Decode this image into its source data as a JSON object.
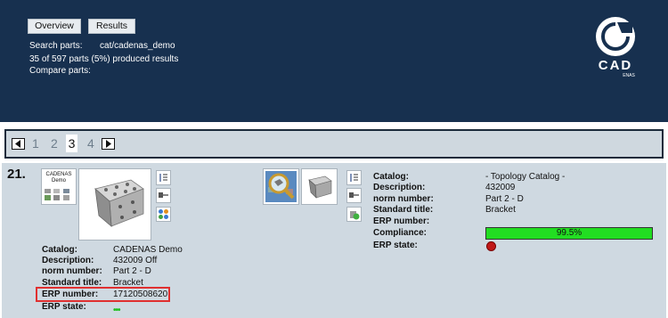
{
  "header": {
    "tabs": [
      {
        "label": "Overview"
      },
      {
        "label": "Results"
      }
    ],
    "search_label": "Search parts:",
    "search_value": "cat/cadenas_demo",
    "summary": "35 of 597 parts (5%) produced results",
    "compare_label": "Compare parts:",
    "logo_text": "CADENAS"
  },
  "pager": {
    "prev_icon": "prev-page-icon",
    "next_icon": "next-page-icon",
    "pages": [
      "1",
      "2",
      "3",
      "4"
    ],
    "current_page": "3"
  },
  "result": {
    "index": "21.",
    "thumb_label": "CADENAS Demo",
    "left": {
      "fields": [
        {
          "label": "Catalog:",
          "value": "CADENAS Demo"
        },
        {
          "label": "Description:",
          "value": "432009 Off"
        },
        {
          "label": "norm number:",
          "value": "Part 2 - D"
        },
        {
          "label": "Standard title:",
          "value": "Bracket"
        },
        {
          "label": "ERP number:",
          "value": "17120508620"
        },
        {
          "label": "ERP state:",
          "value": "•••"
        }
      ]
    },
    "right": {
      "fields": [
        {
          "label": "Catalog:",
          "value": "- Topology Catalog -"
        },
        {
          "label": "Description:",
          "value": "432009"
        },
        {
          "label": "norm number:",
          "value": "Part 2 - D"
        },
        {
          "label": "Standard title:",
          "value": "Bracket"
        },
        {
          "label": "ERP number:",
          "value": ""
        },
        {
          "label": "Compliance:",
          "value": "99.5%"
        },
        {
          "label": "ERP state:",
          "value": ""
        }
      ],
      "compliance": 0.995
    },
    "colors": {
      "compliance_bar": "#22dd22",
      "erp_state_red": "#c01818",
      "erp_state_green": "#22c022",
      "highlight": "#e03030"
    }
  }
}
